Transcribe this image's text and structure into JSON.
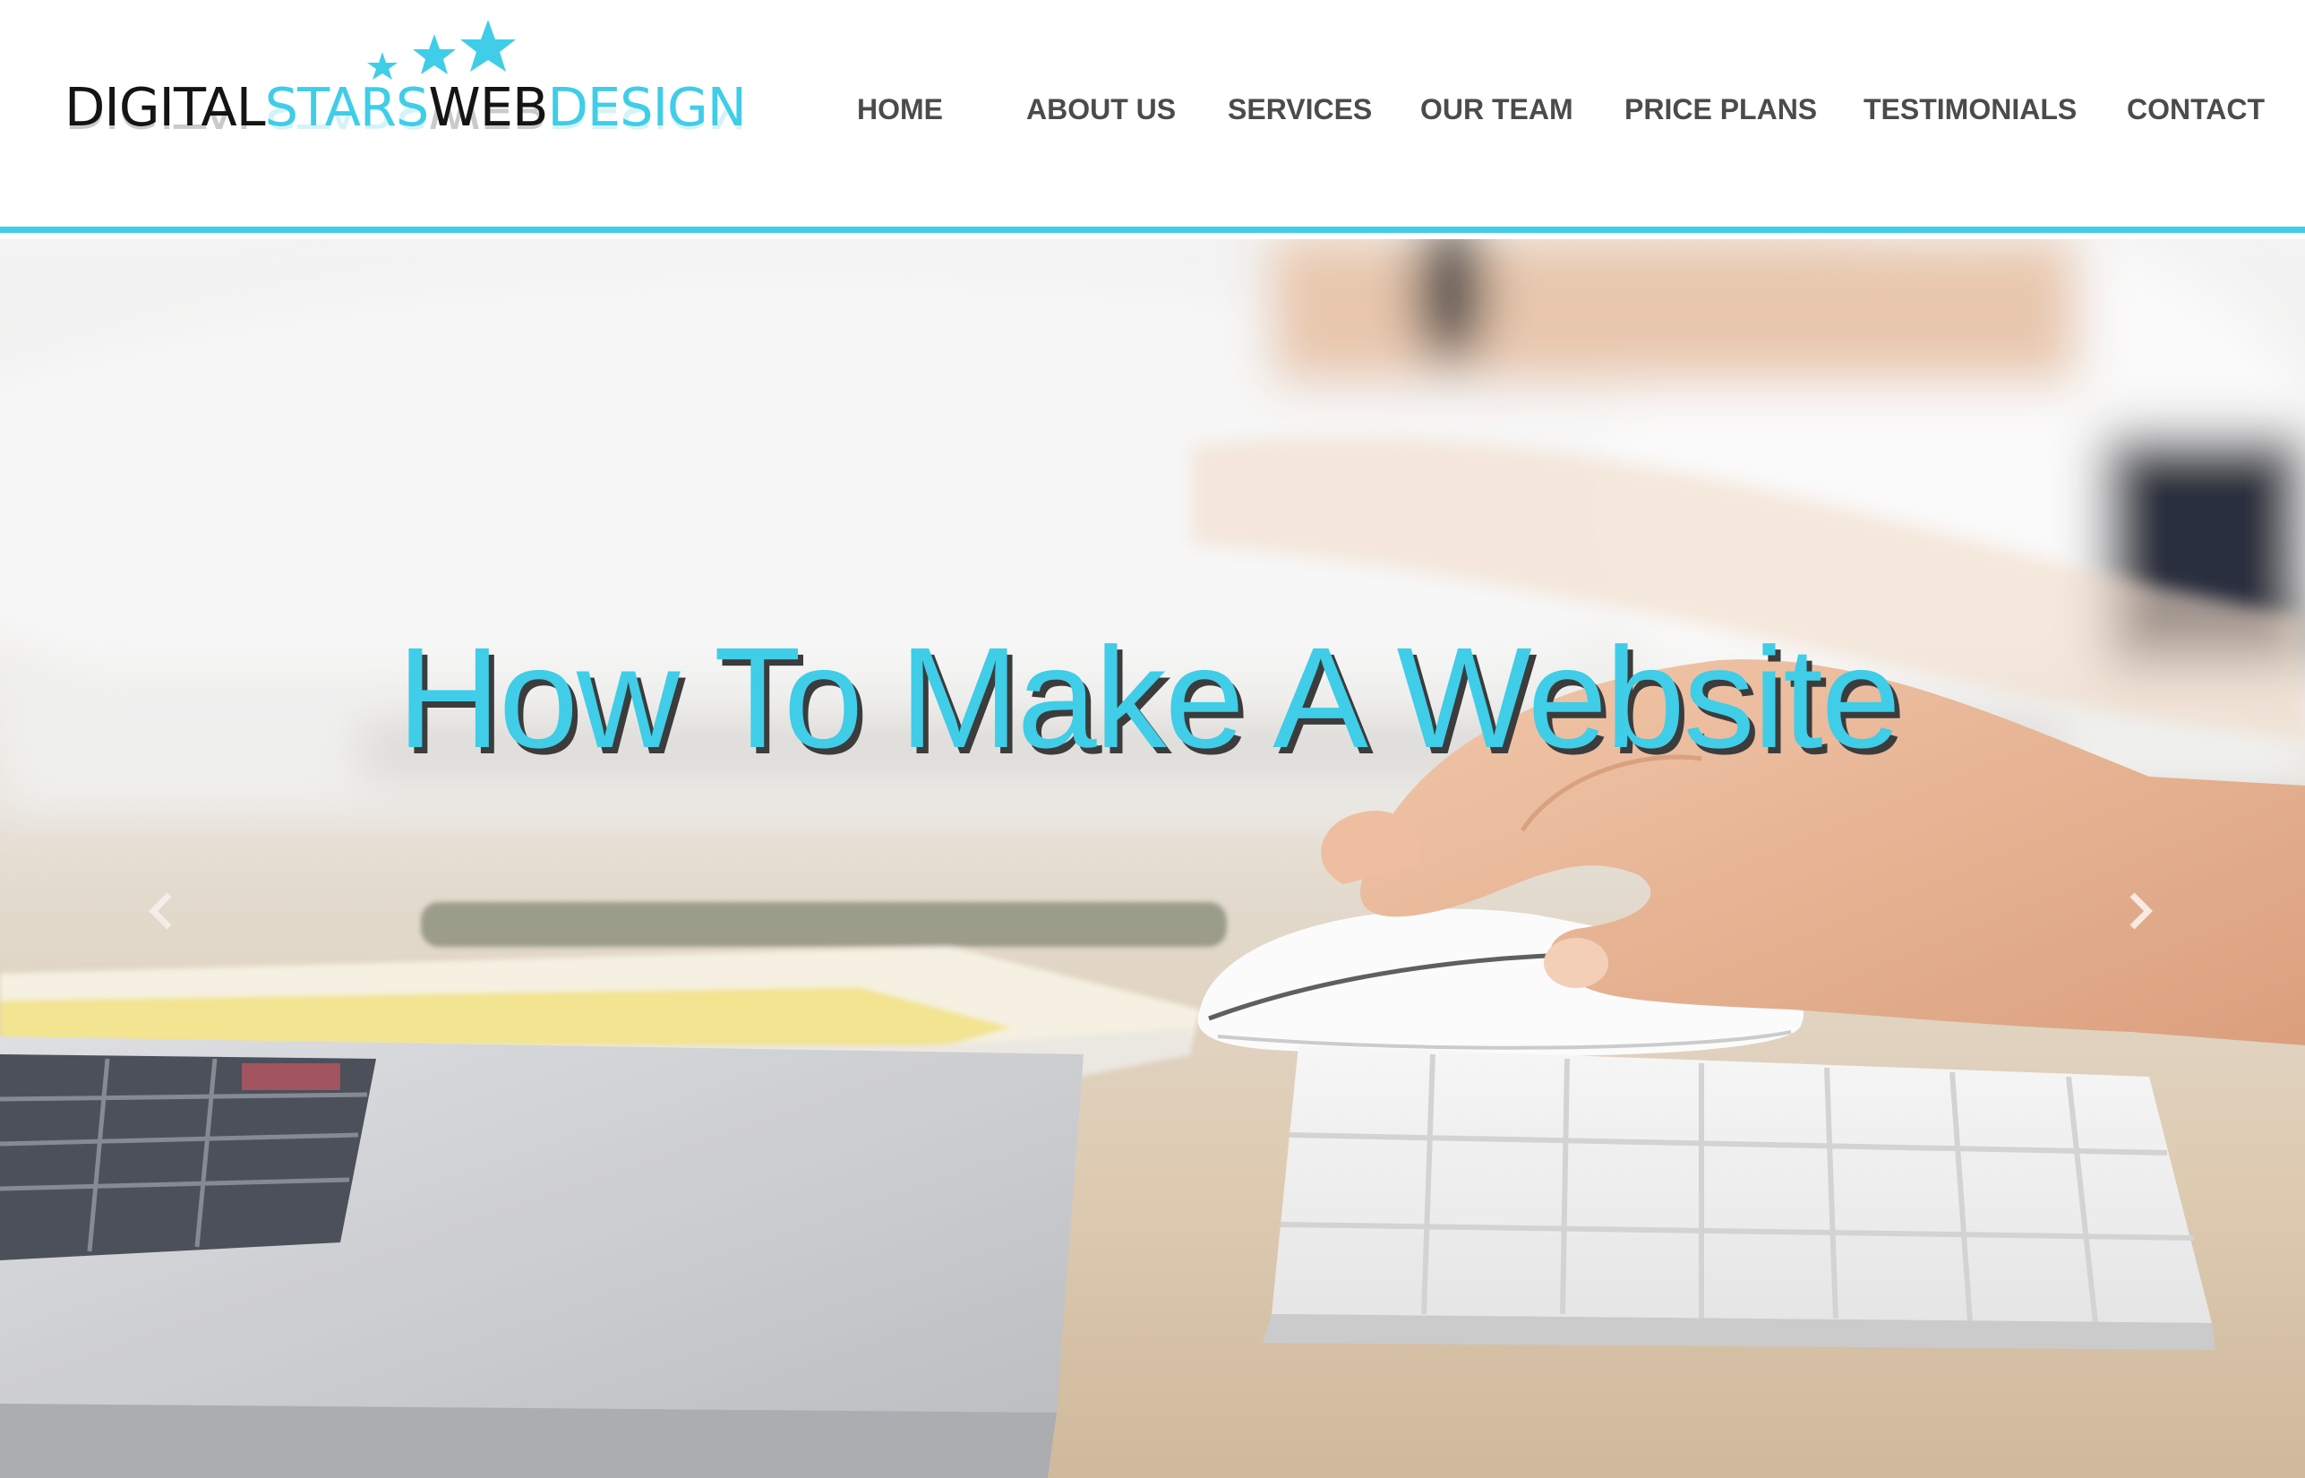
{
  "header": {
    "logo": {
      "part1": "DIGITAL",
      "part2": "STARS",
      "part3": "WEB",
      "part4": "DESIGN"
    },
    "nav": {
      "home": "HOME",
      "about": "ABOUT US",
      "services": "SERVICES",
      "team": "OUR TEAM",
      "price": "PRICE PLANS",
      "testimonials": "TESTIMONIALS",
      "contact": "CONTACT"
    }
  },
  "hero": {
    "title": "How To Make A Website",
    "prev_icon": "chevron-left-icon",
    "next_icon": "chevron-right-icon"
  },
  "colors": {
    "accent": "#3fcde8",
    "nav_text": "#4b4b4b",
    "logo_dark": "#141414",
    "title_shadow": "#3c3c3c"
  }
}
